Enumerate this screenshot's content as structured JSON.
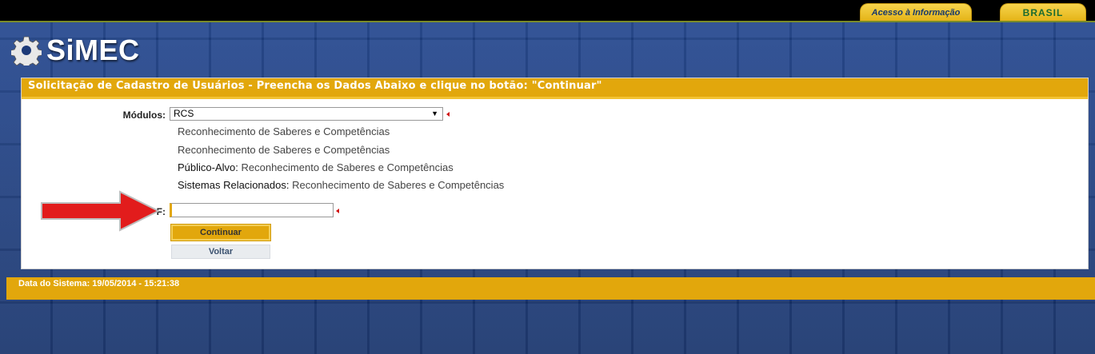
{
  "topbar": {
    "acesso_label": "Acesso à Informação",
    "brasil_label": "BRASIL"
  },
  "logo": {
    "text": "SiMEC",
    "icon": "gear-icon"
  },
  "form": {
    "header": "Solicitação de Cadastro de Usuários - Preencha os Dados Abaixo e clique no botão: \"Continuar\"",
    "modulos_label": "Módulos:",
    "modulos_value": "RCS",
    "desc1": "Reconhecimento de Saberes e Competências",
    "desc2": "Reconhecimento de Saberes e Competências",
    "publico_key": "Público-Alvo:",
    "publico_value": "Reconhecimento de Saberes e Competências",
    "sistemas_key": "Sistemas Relacionados:",
    "sistemas_value": "Reconhecimento de Saberes e Competências",
    "cpf_label": "CPF:",
    "cpf_value": "",
    "continuar_label": "Continuar",
    "voltar_label": "Voltar"
  },
  "footer": {
    "text": "Data do Sistema: 19/05/2014 - 15:21:38"
  },
  "colors": {
    "accent": "#e2a70c",
    "background": "#1d3a78",
    "required": "#d01010",
    "arrow": "#e21c1c"
  }
}
